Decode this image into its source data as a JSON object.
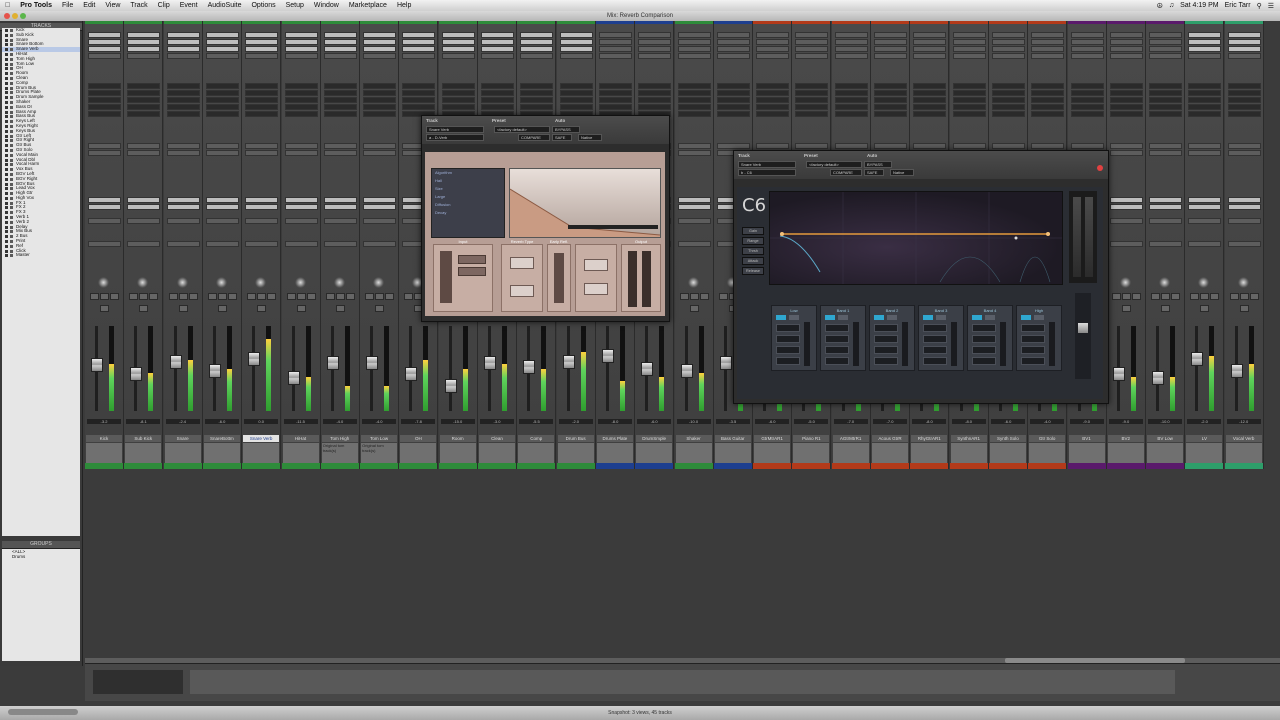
{
  "menubar": {
    "app": "Pro Tools",
    "items": [
      "File",
      "Edit",
      "View",
      "Track",
      "Clip",
      "Event",
      "AudioSuite",
      "Options",
      "Setup",
      "Window",
      "Marketplace",
      "Help"
    ],
    "clock": "Sat 4:19 PM",
    "user": "Eric Tarr"
  },
  "window": {
    "title": "Mix: Reverb Comparison"
  },
  "left_panel": {
    "tracks_header": "TRACKS",
    "tracks": [
      "Kick",
      "Sub Kick",
      "Snare",
      "Snare Bottom",
      "Snare Verb",
      "HiHat",
      "Tom High",
      "Tom Low",
      "OH",
      "Room",
      "Clean",
      "Comp",
      "Drum Bus",
      "Drums Plate",
      "Drum Sample",
      "Shaker",
      "Bass DI",
      "Bass Amp",
      "Bass Bus",
      "Keys Left",
      "Keys Right",
      "Keys Bus",
      "Gtr Left",
      "Gtr Right",
      "Gtr Bus",
      "Gtr Solo",
      "Vocal Main",
      "Vocal Dbl",
      "Vocal Harm",
      "Vox Bus",
      "BGV Left",
      "BGV Right",
      "BGV Bus",
      "Lead Vox",
      "High Gtr",
      "High Vox",
      "FX 1",
      "FX 2",
      "FX 3",
      "Verb 1",
      "Verb 2",
      "Delay",
      "Mix Bus",
      "2 Bus",
      "Print",
      "Ref",
      "Click",
      "Master"
    ],
    "selected_track_index": 4,
    "groups_header": "GROUPS",
    "groups": [
      "<ALL>",
      "Drums"
    ]
  },
  "mixer": {
    "strips": [
      {
        "name": "Kick",
        "comment": "",
        "color": "#2e8b3a",
        "volume": "-3.2",
        "fader": 0.42,
        "meter": 0.55,
        "insert_filled": true
      },
      {
        "name": "Sub Kick",
        "comment": "",
        "color": "#2e8b3a",
        "volume": "-8.1",
        "fader": 0.55,
        "meter": 0.45,
        "insert_filled": true
      },
      {
        "name": "Snare",
        "comment": "",
        "color": "#2e8b3a",
        "volume": "-2.4",
        "fader": 0.38,
        "meter": 0.6,
        "insert_filled": true
      },
      {
        "name": "SnareBottm",
        "comment": "",
        "color": "#2e8b3a",
        "volume": "-6.0",
        "fader": 0.5,
        "meter": 0.5,
        "insert_filled": true
      },
      {
        "name": "Snare Verb",
        "comment": "",
        "color": "#2e8b3a",
        "volume": "0.0",
        "fader": 0.35,
        "meter": 0.85,
        "insert_filled": true,
        "selected": true
      },
      {
        "name": "HiHat",
        "comment": "",
        "color": "#2e8b3a",
        "volume": "-11.5",
        "fader": 0.6,
        "meter": 0.4,
        "insert_filled": true
      },
      {
        "name": "Tom High",
        "comment": "Original tom track(s)",
        "color": "#2e8b3a",
        "volume": "-4.0",
        "fader": 0.4,
        "meter": 0.3,
        "insert_filled": true
      },
      {
        "name": "Tom Low",
        "comment": "Original tom track(s)",
        "color": "#2e8b3a",
        "volume": "-4.0",
        "fader": 0.4,
        "meter": 0.3,
        "insert_filled": true
      },
      {
        "name": "OH",
        "comment": "",
        "color": "#2e8b3a",
        "volume": "-7.8",
        "fader": 0.55,
        "meter": 0.6,
        "insert_filled": true
      },
      {
        "name": "Room",
        "comment": "",
        "color": "#2e8b3a",
        "volume": "-15.0",
        "fader": 0.7,
        "meter": 0.5,
        "insert_filled": true
      },
      {
        "name": "Clean",
        "comment": "",
        "color": "#2e8b3a",
        "volume": "-3.0",
        "fader": 0.4,
        "meter": 0.55,
        "insert_filled": true
      },
      {
        "name": "Comp",
        "comment": "",
        "color": "#2e8b3a",
        "volume": "-5.5",
        "fader": 0.45,
        "meter": 0.5,
        "insert_filled": true
      },
      {
        "name": "Drum Bus",
        "comment": "",
        "color": "#2e8b3a",
        "volume": "-2.0",
        "fader": 0.38,
        "meter": 0.7,
        "insert_filled": true
      },
      {
        "name": "Drums Plate",
        "comment": "",
        "color": "#1e3f8f",
        "volume": "-8.0",
        "fader": 0.3,
        "meter": 0.35,
        "insert_filled": false
      },
      {
        "name": "DrumSmple",
        "comment": "",
        "color": "#1e3f8f",
        "volume": "-6.0",
        "fader": 0.48,
        "meter": 0.4,
        "insert_filled": false
      },
      {
        "name": "Shaker",
        "comment": "",
        "color": "#2e8b3a",
        "volume": "-10.0",
        "fader": 0.5,
        "meter": 0.45,
        "insert_filled": false
      },
      {
        "name": "Bass Guitar",
        "comment": "",
        "color": "#1e3f8f",
        "volume": "-3.5",
        "fader": 0.4,
        "meter": 0.5,
        "insert_filled": false
      },
      {
        "name": "GtrMtrAR1",
        "comment": "",
        "color": "#b33a1a",
        "volume": "-6.0",
        "fader": 0.45,
        "meter": 0.4,
        "insert_filled": false
      },
      {
        "name": "Piano R1",
        "comment": "",
        "color": "#b33a1a",
        "volume": "-5.0",
        "fader": 0.5,
        "meter": 0.4,
        "insert_filled": false
      },
      {
        "name": "AGtrMtrR1",
        "comment": "",
        "color": "#b33a1a",
        "volume": "-7.0",
        "fader": 0.5,
        "meter": 0.4,
        "insert_filled": false
      },
      {
        "name": "Acous GtrR",
        "comment": "",
        "color": "#b33a1a",
        "volume": "-7.0",
        "fader": 0.5,
        "meter": 0.4,
        "insert_filled": false
      },
      {
        "name": "RhyGtrAR1",
        "comment": "",
        "color": "#b33a1a",
        "volume": "-8.0",
        "fader": 0.5,
        "meter": 0.4,
        "insert_filled": false
      },
      {
        "name": "SynthnAR1",
        "comment": "",
        "color": "#b33a1a",
        "volume": "-8.0",
        "fader": 0.5,
        "meter": 0.4,
        "insert_filled": false
      },
      {
        "name": "Synth Solo",
        "comment": "",
        "color": "#b33a1a",
        "volume": "-6.0",
        "fader": 0.45,
        "meter": 0.45,
        "insert_filled": false
      },
      {
        "name": "Gtr Solo",
        "comment": "",
        "color": "#b33a1a",
        "volume": "-4.0",
        "fader": 0.4,
        "meter": 0.5,
        "insert_filled": false
      },
      {
        "name": "BV1",
        "comment": "",
        "color": "#5a1a6b",
        "volume": "-9.0",
        "fader": 0.55,
        "meter": 0.4,
        "insert_filled": false
      },
      {
        "name": "BV2",
        "comment": "",
        "color": "#5a1a6b",
        "volume": "-9.0",
        "fader": 0.55,
        "meter": 0.4,
        "insert_filled": false
      },
      {
        "name": "BV Low",
        "comment": "",
        "color": "#5a1a6b",
        "volume": "-10.0",
        "fader": 0.6,
        "meter": 0.4,
        "insert_filled": false
      },
      {
        "name": "LV",
        "comment": "",
        "color": "#2e9e6a",
        "volume": "-2.0",
        "fader": 0.35,
        "meter": 0.65,
        "insert_filled": true
      },
      {
        "name": "Vocal Verb",
        "comment": "",
        "color": "#2e9e6a",
        "volume": "-12.0",
        "fader": 0.5,
        "meter": 0.55,
        "insert_filled": true
      }
    ]
  },
  "dverb": {
    "track_label": "Track",
    "preset_label": "Preset",
    "auto_label": "Auto",
    "track_value": "Snare Verb",
    "insert_value": "a - D-Verb",
    "preset_value": "<factory default>",
    "compare": "COMPARE",
    "bypass": "BYPASS",
    "safe": "SAFE",
    "native": "Native",
    "reverb_type": "Reverb Type",
    "display_lines": [
      "Algorithm",
      "Hall",
      "Size",
      "Large",
      "Diffusion",
      "Decay"
    ],
    "section_input": "Input",
    "section_early": "Early Refl.",
    "section_output": "Output"
  },
  "c6": {
    "track_label": "Track",
    "preset_label": "Preset",
    "auto_label": "Auto",
    "track_value": "Snare Verb",
    "insert_value": "b - C6",
    "preset_value": "<factory default>",
    "compare": "COMPARE",
    "bypass": "BYPASS",
    "safe": "SAFE",
    "native": "Native",
    "logo": "C6",
    "side_buttons": [
      "Gain",
      "Range",
      "Thrsh",
      "Attack",
      "Release"
    ],
    "bands": [
      "Low",
      "Band 1",
      "Band 2",
      "Band 3",
      "Band 4",
      "High"
    ]
  },
  "status": {
    "text": "Snapshot: 3 views, 45 tracks"
  },
  "colors": {
    "selected_nameplate_text": "#1e3c8c",
    "meter_green": "#2f9e2f",
    "eq_curve": "#e49a3c",
    "close": "#e24141"
  }
}
